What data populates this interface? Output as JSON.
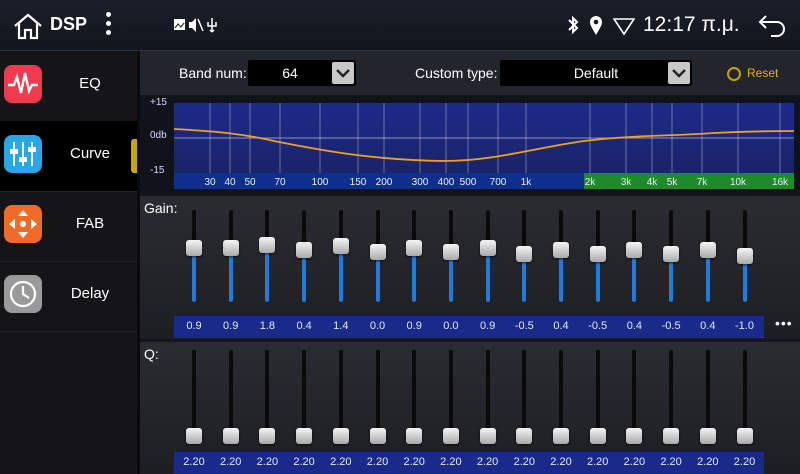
{
  "status_bar": {
    "title": "DSP",
    "time": "12:17 π.μ."
  },
  "sidebar": {
    "items": [
      {
        "label": "EQ",
        "icon": "eq-waveform-icon",
        "color": "#f03a4e"
      },
      {
        "label": "Curve",
        "icon": "sliders-icon",
        "color": "#29a6e8",
        "active": true
      },
      {
        "label": "FAB",
        "icon": "fader-balance-icon",
        "color": "#f06a28"
      },
      {
        "label": "Delay",
        "icon": "clock-icon",
        "color": "#9a9a9a"
      }
    ]
  },
  "toolbar": {
    "band_num_label": "Band num:",
    "band_num_value": "64",
    "custom_type_label": "Custom type:",
    "custom_type_value": "Default",
    "reset_label": "Reset"
  },
  "curve": {
    "y_labels": [
      "+15",
      "0db",
      "-15"
    ],
    "freq_labels": [
      "30",
      "40",
      "50",
      "70",
      "100",
      "150",
      "200",
      "300",
      "400",
      "500",
      "700",
      "1k",
      "2k",
      "3k",
      "4k",
      "5k",
      "7k",
      "10k",
      "16k"
    ],
    "line_color": "#f0a020"
  },
  "gain": {
    "label": "Gain:",
    "values": [
      "0.9",
      "0.9",
      "1.8",
      "0.4",
      "1.4",
      "0.0",
      "0.9",
      "0.0",
      "0.9",
      "-0.5",
      "0.4",
      "-0.5",
      "0.4",
      "-0.5",
      "0.4",
      "-1.0"
    ]
  },
  "q": {
    "label": "Q:",
    "values": [
      "2.20",
      "2.20",
      "2.20",
      "2.20",
      "2.20",
      "2.20",
      "2.20",
      "2.20",
      "2.20",
      "2.20",
      "2.20",
      "2.20",
      "2.20",
      "2.20",
      "2.20",
      "2.20"
    ]
  },
  "more_label": "•••"
}
